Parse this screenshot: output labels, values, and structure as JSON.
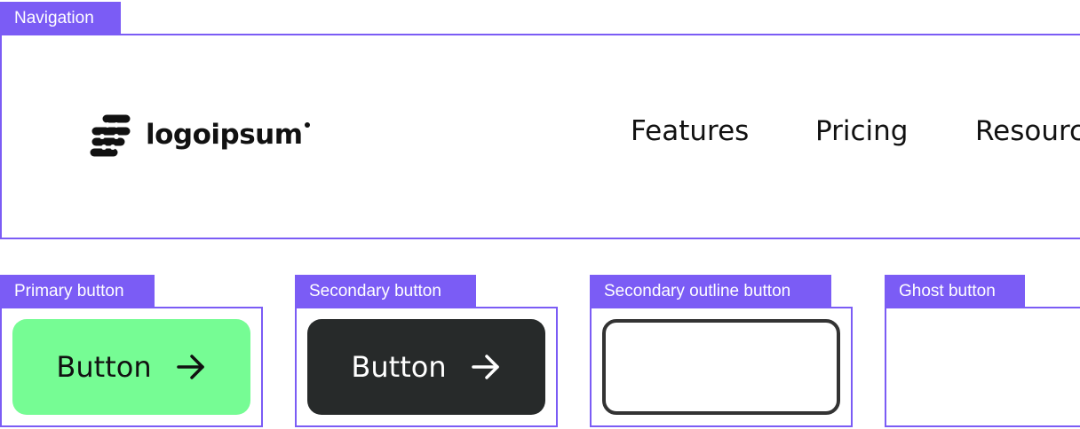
{
  "navigation_section": {
    "tag": "Navigation",
    "logo_text": "logoipsum",
    "links": [
      "Features",
      "Pricing",
      "Resources"
    ]
  },
  "button_sections": {
    "primary": {
      "tag": "Primary button",
      "label": "Button",
      "icon": "arrow-right-icon",
      "color": "#76fc94"
    },
    "secondary": {
      "tag": "Secondary button",
      "label": "Button",
      "icon": "arrow-right-icon",
      "color": "#272a2a"
    },
    "secondary_outline": {
      "tag": "Secondary outline button"
    },
    "ghost": {
      "tag": "Ghost button"
    }
  },
  "colors": {
    "accent": "#7b5cf5",
    "primary_button": "#76fc94",
    "secondary_button": "#272a2a",
    "text": "#111111"
  }
}
